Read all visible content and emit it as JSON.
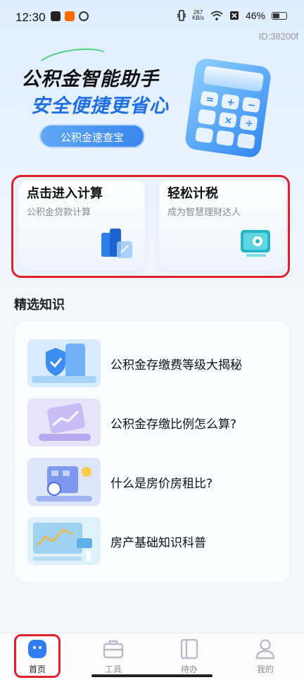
{
  "status_bar": {
    "time": "12:30",
    "net_speed_value": "267",
    "net_speed_unit": "KB/s",
    "battery": "46%"
  },
  "device_id": "ID:38200f",
  "banner": {
    "title": "公积金智能助手",
    "subtitle": "安全便捷更省心",
    "button": "公积金速查宝",
    "accent": "#1f6fe0"
  },
  "cards": [
    {
      "title": "点击进入计算",
      "subtitle": "公积金贷款计算",
      "icon": "calculator-blocks-icon"
    },
    {
      "title": "轻松计税",
      "subtitle": "成为智慧理财达人",
      "icon": "monitor-icon"
    }
  ],
  "section": {
    "title": "精选知识"
  },
  "articles": [
    {
      "title": "公积金存缴费等级大揭秘",
      "thumb": "shield-phone-thumb"
    },
    {
      "title": "公积金存缴比例怎么算?",
      "thumb": "chart-card-thumb"
    },
    {
      "title": "什么是房价房租比?",
      "thumb": "building-coin-thumb"
    },
    {
      "title": "房产基础知识科普",
      "thumb": "dashboard-thumb"
    }
  ],
  "tabs": [
    {
      "label": "首页",
      "icon": "home-icon",
      "active": true
    },
    {
      "label": "工具",
      "icon": "toolbox-icon",
      "active": false
    },
    {
      "label": "待办",
      "icon": "notebook-icon",
      "active": false
    },
    {
      "label": "我的",
      "icon": "user-icon",
      "active": false
    }
  ],
  "colors": {
    "highlight": "#e0202a",
    "brand_blue": "#3a86ee"
  }
}
